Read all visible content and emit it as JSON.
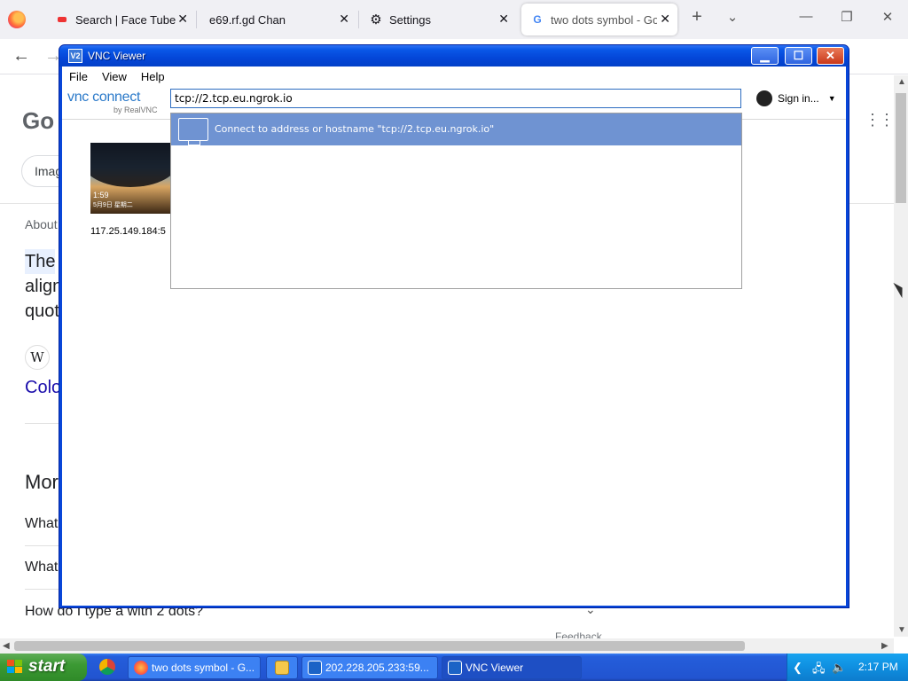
{
  "browser": {
    "tabs": [
      {
        "title": "Search | Face Tube",
        "icon": "video-icon"
      },
      {
        "title": "e69.rf.gd Chan",
        "icon": "page-icon"
      },
      {
        "title": "Settings",
        "icon": "gear-icon"
      },
      {
        "title": "two dots symbol - Goo",
        "icon": "google-icon"
      }
    ],
    "active_tab": 3
  },
  "google_page": {
    "logo_fragment": "Go",
    "pill_fragment": "Imag",
    "about_fragment": "About",
    "snippet_lines": [
      "The",
      "align",
      "quot"
    ],
    "wiki_letter": "W",
    "link_fragment": "Colo",
    "more_fragment": "Mor",
    "questions": [
      "What",
      "What",
      "How do I type a with 2 dots?"
    ],
    "feedback": "Feedback"
  },
  "vnc": {
    "title": "VNC Viewer",
    "icon_text": "V2",
    "menu": [
      "File",
      "View",
      "Help"
    ],
    "brand_main": "vnc connect",
    "brand_by": "by RealVNC",
    "address_value": "tcp://2.tcp.eu.ngrok.io",
    "signin_label": "Sign in...",
    "suggestion": "Connect to address or hostname \"tcp://2.tcp.eu.ngrok.io\"",
    "thumbnail_label": "117.25.149.184:5",
    "thumbnail_clock": "1:59",
    "thumbnail_date": "5月9日 星期二"
  },
  "taskbar": {
    "start_label": "start",
    "tasks": [
      {
        "label": "two dots symbol - G...",
        "icon": "firefox-icon"
      },
      {
        "label": "",
        "icon": "folder-icon"
      },
      {
        "label": "202.228.205.233:59...",
        "icon": "vnc-icon"
      },
      {
        "label": "VNC Viewer",
        "icon": "vnc-icon"
      }
    ],
    "clock": "2:17 PM"
  },
  "colors": {
    "xp_blue": "#245edb",
    "xp_start_green": "#3c9a34",
    "vnc_selection": "#6f93d2",
    "google_link": "#1a0dab"
  }
}
